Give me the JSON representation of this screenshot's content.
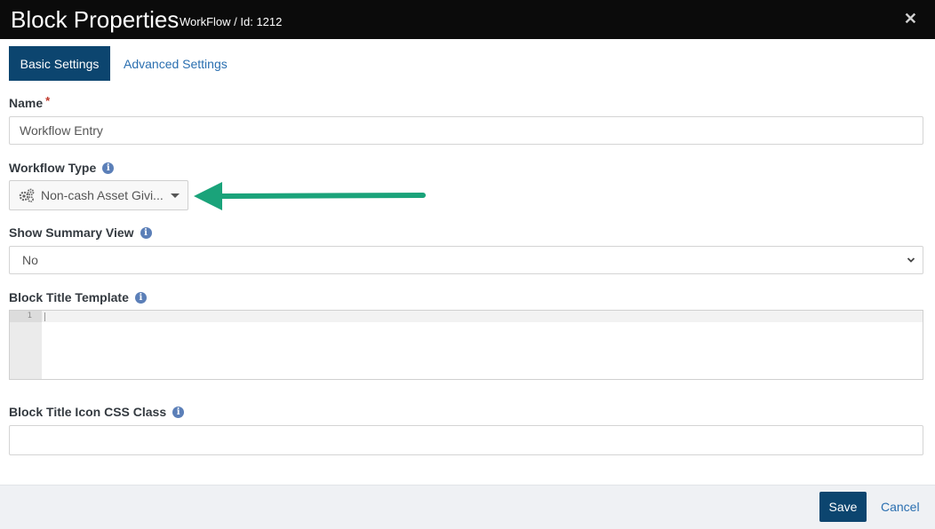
{
  "dialog": {
    "title": "Block Properties",
    "subtitle": "WorkFlow / Id: 1212",
    "close_glyph": "✕"
  },
  "tabs": [
    {
      "label": "Basic Settings",
      "active": true
    },
    {
      "label": "Advanced Settings",
      "active": false
    }
  ],
  "fields": {
    "name": {
      "label": "Name",
      "required_marker": "*",
      "value": "Workflow Entry"
    },
    "workflow_type": {
      "label": "Workflow Type",
      "value": "Non-cash Asset Givi...",
      "icon": "gears-icon"
    },
    "show_summary": {
      "label": "Show Summary View",
      "value": "No"
    },
    "block_title_template": {
      "label": "Block Title Template",
      "line_number": "1",
      "value": ""
    },
    "block_title_icon_css": {
      "label": "Block Title Icon CSS Class",
      "value": ""
    }
  },
  "info_glyph": "i",
  "footer": {
    "save_label": "Save",
    "cancel_label": "Cancel"
  },
  "colors": {
    "header_bg": "#0b0b0b",
    "primary": "#0c456f",
    "link": "#2a6fb0",
    "arrow": "#1aa37a",
    "required": "#c0392b",
    "info": "#5b7fb8"
  }
}
